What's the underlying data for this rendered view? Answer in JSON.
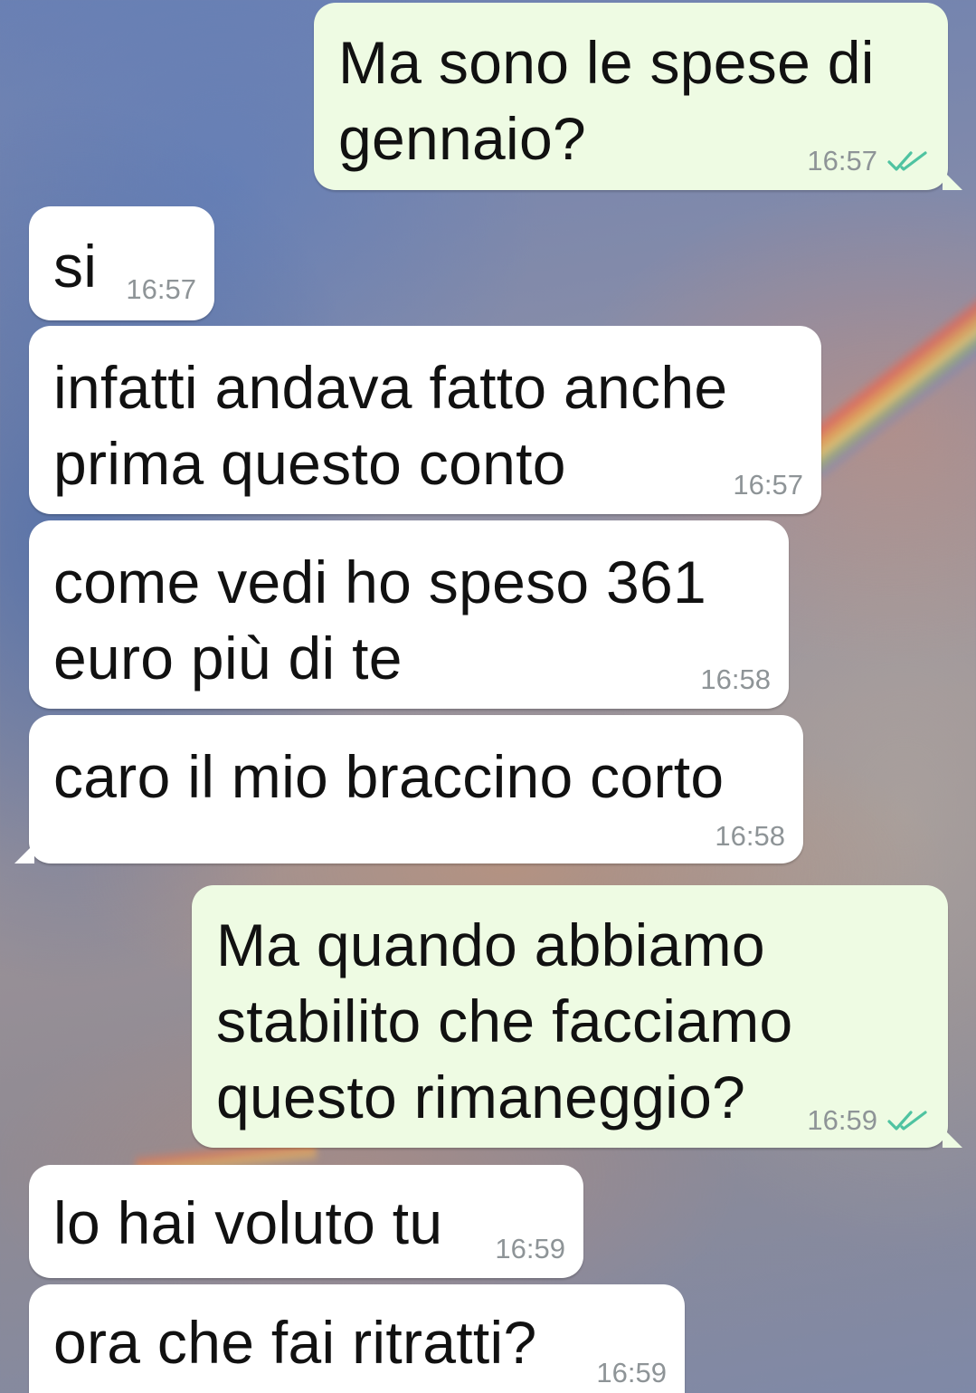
{
  "conversation": {
    "messages": [
      {
        "direction": "out",
        "text": "Ma sono le spese di\ngennaio?",
        "time": "16:57",
        "status_icon": "double-check-icon",
        "status_color": "#4fc3a1"
      },
      {
        "direction": "in",
        "text": "si",
        "time": "16:57"
      },
      {
        "direction": "in",
        "text": "infatti andava fatto anche\nprima questo conto",
        "time": "16:57"
      },
      {
        "direction": "in",
        "text": "come vedi ho speso 361\neuro più di te",
        "time": "16:58"
      },
      {
        "direction": "in",
        "text": "caro il mio braccino corto",
        "time": "16:58"
      },
      {
        "direction": "out",
        "text": "Ma quando abbiamo\nstabilito che facciamo\nquesto rimaneggio?",
        "time": "16:59",
        "status_icon": "double-check-icon",
        "status_color": "#4fc3a1"
      },
      {
        "direction": "in",
        "text": "lo hai voluto tu",
        "time": "16:59"
      },
      {
        "direction": "in",
        "text": "ora che fai ritratti?",
        "time": "16:59"
      }
    ]
  },
  "colors": {
    "incoming_bubble": "#ffffff",
    "outgoing_bubble": "#eefbe3",
    "timestamp": "#8e9497",
    "read_ticks": "#4fc3a1"
  }
}
